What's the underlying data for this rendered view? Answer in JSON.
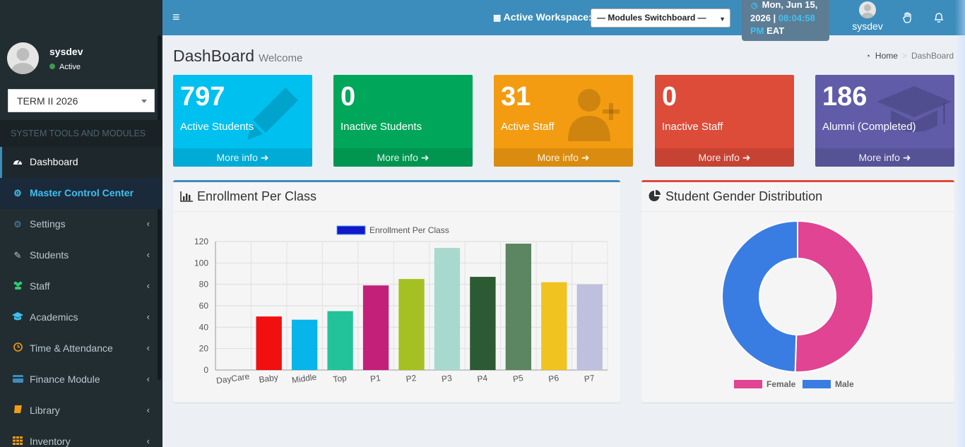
{
  "user": {
    "name": "sysdev",
    "status": "Active"
  },
  "term": {
    "selected": "TERM II 2026"
  },
  "sidebar": {
    "header": "SYSTEM TOOLS AND MODULES",
    "items": [
      {
        "label": "Dashboard",
        "icon": "dashboard-icon"
      },
      {
        "label": "Master Control Center",
        "icon": "cogs-icon"
      },
      {
        "label": "Settings",
        "icon": "cogs-icon"
      },
      {
        "label": "Students",
        "icon": "edit-icon"
      },
      {
        "label": "Staff",
        "icon": "users-icon"
      },
      {
        "label": "Academics",
        "icon": "graduation-cap-icon"
      },
      {
        "label": "Time & Attendance",
        "icon": "clock-icon"
      },
      {
        "label": "Finance Module",
        "icon": "credit-card-icon"
      },
      {
        "label": "Library",
        "icon": "book-icon"
      },
      {
        "label": "Inventory",
        "icon": "grid-icon"
      }
    ]
  },
  "topbar": {
    "workspace_label": "Active Workspace:",
    "workspace_value": "— Modules Switchboard —",
    "clock_date": "Mon, Jun 15, 2026 |",
    "clock_time": "08:04:58 PM",
    "clock_zone": "EAT",
    "username": "sysdev"
  },
  "page": {
    "title": "DashBoard",
    "subtitle": "Welcome"
  },
  "breadcrumb": {
    "home": "Home",
    "sep": ">",
    "current": "DashBoard"
  },
  "stats": [
    {
      "value": "797",
      "label": "Active Students",
      "more": "More info",
      "color": "#00c0ef",
      "icon": "pencil-icon"
    },
    {
      "value": "0",
      "label": "Inactive Students",
      "more": "More info",
      "color": "#00a65a",
      "icon": "none"
    },
    {
      "value": "31",
      "label": "Active Staff",
      "more": "More info",
      "color": "#f39c12",
      "icon": "user-plus-icon"
    },
    {
      "value": "0",
      "label": "Inactive Staff",
      "more": "More info",
      "color": "#dd4b39",
      "icon": "none"
    },
    {
      "value": "186",
      "label": "Alumni (Completed)",
      "more": "More info",
      "color": "#605ca8",
      "icon": "graduation-cap-icon"
    }
  ],
  "enrollment": {
    "title": "Enrollment Per Class",
    "chart_data": {
      "type": "bar",
      "categories": [
        "DayCare",
        "Baby",
        "Middle",
        "Top",
        "P1",
        "P2",
        "P3",
        "P4",
        "P5",
        "P6",
        "P7"
      ],
      "values": [
        0,
        50,
        47,
        55,
        79,
        85,
        114,
        87,
        118,
        82,
        80
      ],
      "colors": [
        "#cccccc",
        "#f10f0f",
        "#08b5ea",
        "#22c39a",
        "#c3207a",
        "#a5c022",
        "#a7d9cf",
        "#2c5a33",
        "#5c8562",
        "#f0c320",
        "#bec0dd"
      ],
      "series": [
        {
          "name": "Enrollment Per Class",
          "color": "#1018c8"
        }
      ],
      "yticks": [
        0,
        20,
        40,
        60,
        80,
        100,
        120
      ],
      "ylim": [
        0,
        120
      ]
    }
  },
  "gender": {
    "title": "Student Gender Distribution",
    "chart_data": {
      "type": "pie",
      "labels": [
        "Female",
        "Male"
      ],
      "values": [
        50.5,
        49.5
      ],
      "colors": [
        "#e04492",
        "#3a7de2"
      ]
    }
  },
  "colors": {
    "primary": "#3c8dbc",
    "sidebar": "#222d32",
    "accent": "#3ec0f0"
  }
}
